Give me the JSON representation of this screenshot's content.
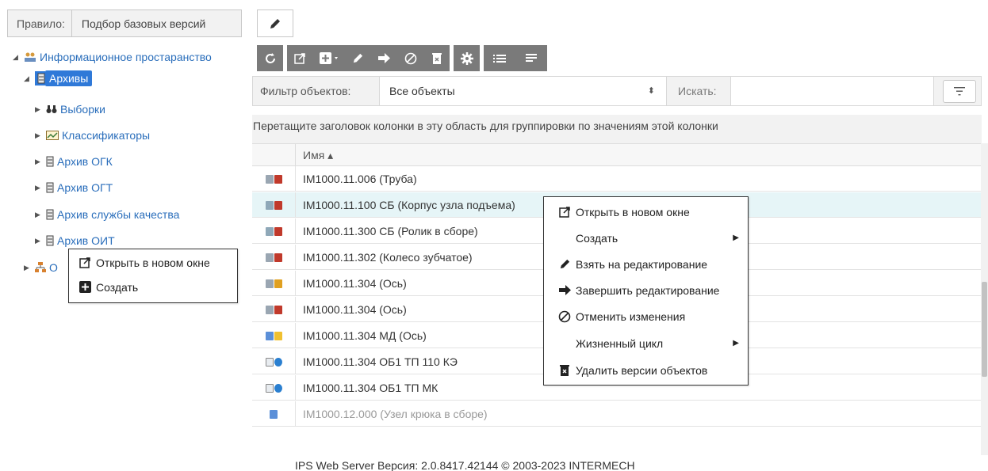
{
  "rule": {
    "label": "Правило:",
    "value": "Подбор базовых версий"
  },
  "tree": {
    "root": "Информационное простаранство",
    "selected": "Архивы",
    "children": [
      "Выборки",
      "Классификаторы",
      "Архив ОГК",
      "Архив ОГТ",
      "Архив службы качества",
      "Архив ОИТ"
    ],
    "partial": "О"
  },
  "filter": {
    "label": "Фильтр объектов:",
    "value": "Все объекты",
    "search_label": "Искать:",
    "search_value": ""
  },
  "group_hint": "Перетащите заголовок колонки в эту область для группировки по значениям этой колонки",
  "grid": {
    "column_name": "Имя ▴",
    "rows": [
      "IM1000.11.006 (Труба)",
      "IM1000.11.100 СБ (Корпус узла подъема)",
      "IM1000.11.300 СБ (Ролик в сборе)",
      "IM1000.11.302 (Колесо зубчатое)",
      "IM1000.11.304 (Ось)",
      "IM1000.11.304 (Ось)",
      "IM1000.11.304 МД (Ось)",
      "IM1000.11.304 ОБ1 ТП 110 КЭ",
      "IM1000.11.304 ОБ1 ТП МК",
      "IM1000.12.000 (Узел крюка в сборе)"
    ]
  },
  "context_menu_grid": [
    "Открыть в новом окне",
    "Создать",
    "Взять на редактирование",
    "Завершить редактирование",
    "Отменить изменения",
    "Жизненный цикл",
    "Удалить версии объектов"
  ],
  "context_menu_tree": [
    "Открыть в новом окне",
    "Создать"
  ],
  "footer": "IPS Web Server Версия: 2.0.8417.42144 © 2003-2023 INTERMECH",
  "colors": {
    "toolbar": "#7a7a7a",
    "selected": "#2f79d8",
    "link": "#2a6ebb",
    "row_highlight": "#e6f5f7"
  }
}
